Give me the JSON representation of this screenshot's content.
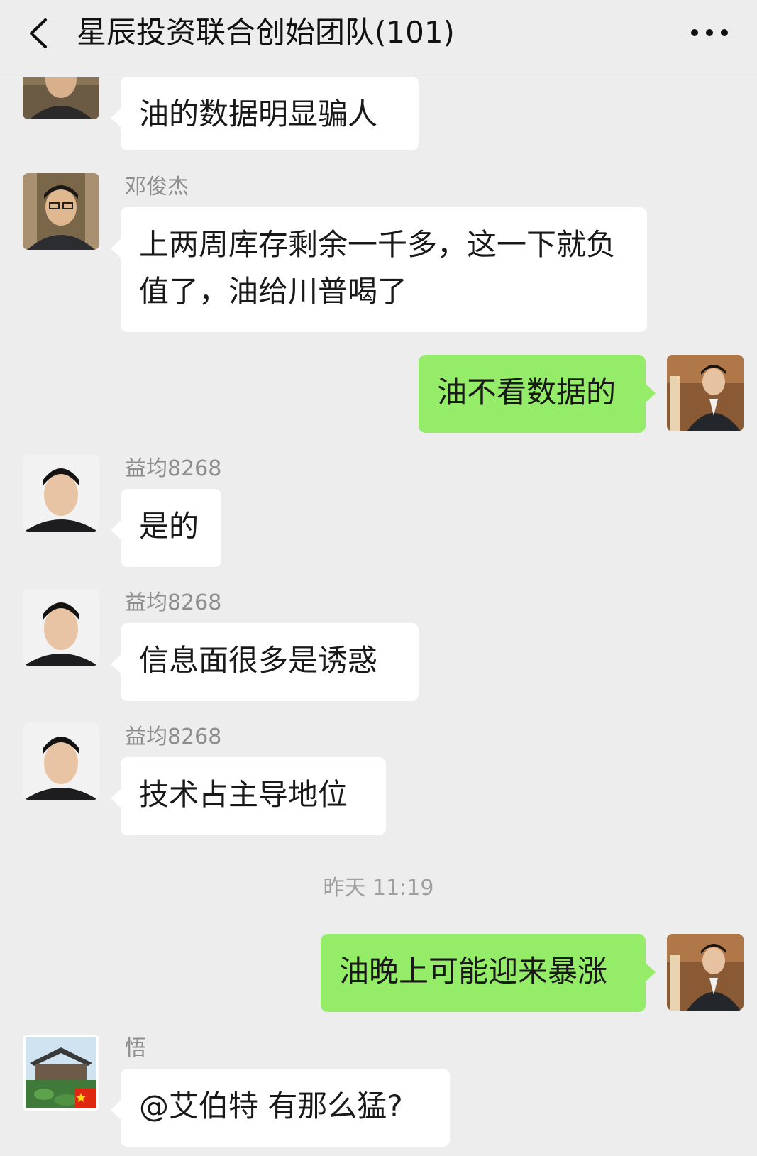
{
  "header": {
    "title": "星辰投资联合创始团队(101)"
  },
  "icons": {
    "back": "chevron-left-icon",
    "more": "more-dots-icon"
  },
  "colors": {
    "sent_bubble": "#95ec69",
    "received_bubble": "#ffffff",
    "background": "#ededed"
  },
  "messages": [
    {
      "direction": "in",
      "sender": "",
      "text": "油的数据明显骗人"
    },
    {
      "direction": "in",
      "sender": "邓俊杰",
      "text": "上两周库存剩余一千多，这一下就负值了，油给川普喝了"
    },
    {
      "direction": "out",
      "text": "油不看数据的"
    },
    {
      "direction": "in",
      "sender": "益均8268",
      "text": "是的"
    },
    {
      "direction": "in",
      "sender": "益均8268",
      "text": "信息面很多是诱惑"
    },
    {
      "direction": "in",
      "sender": "益均8268",
      "text": "技术占主导地位"
    },
    {
      "type": "timestamp",
      "text": "昨天 11:19"
    },
    {
      "direction": "out",
      "text": "油晚上可能迎来暴涨"
    },
    {
      "direction": "in",
      "sender": "悟",
      "text": "@艾伯特  有那么猛?"
    }
  ]
}
